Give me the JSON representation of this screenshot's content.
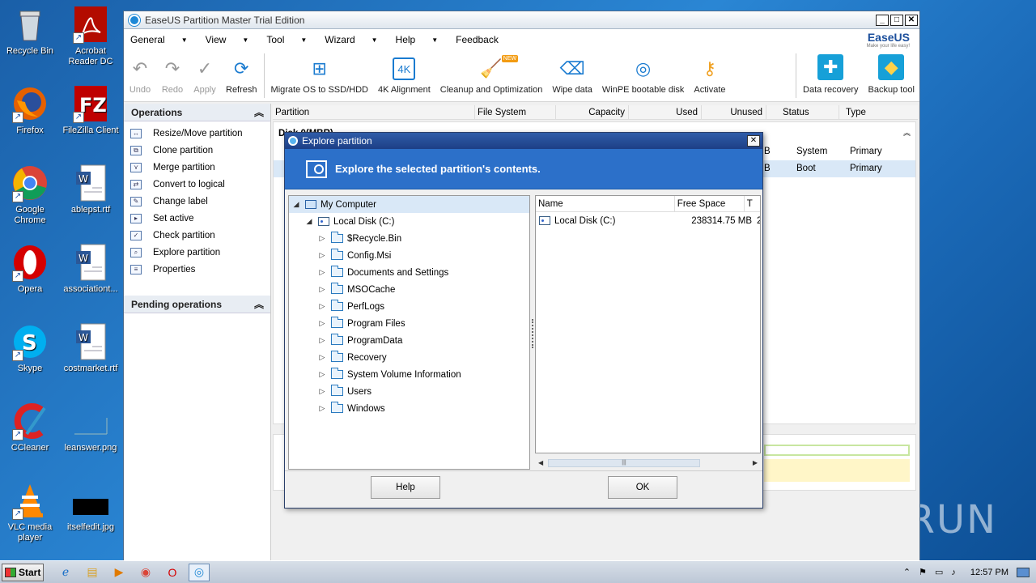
{
  "desktop": {
    "icons": [
      {
        "label": "Recycle Bin",
        "icon": "recycle-bin-icon"
      },
      {
        "label": "Acrobat Reader DC",
        "icon": "acrobat-icon"
      },
      {
        "label": "Firefox",
        "icon": "firefox-icon"
      },
      {
        "label": "FileZilla Client",
        "icon": "filezilla-icon"
      },
      {
        "label": "Google Chrome",
        "icon": "chrome-icon"
      },
      {
        "label": "ablepst.rtf",
        "icon": "word-doc-icon"
      },
      {
        "label": "Opera",
        "icon": "opera-icon"
      },
      {
        "label": "associationt...",
        "icon": "word-doc-icon"
      },
      {
        "label": "Skype",
        "icon": "skype-icon"
      },
      {
        "label": "costmarket.rtf",
        "icon": "word-doc-icon"
      },
      {
        "label": "CCleaner",
        "icon": "ccleaner-icon"
      },
      {
        "label": "leanswer.png",
        "icon": "image-file-icon"
      },
      {
        "label": "VLC media player",
        "icon": "vlc-icon"
      },
      {
        "label": "itselfedit.jpg",
        "icon": "image-file-icon"
      }
    ],
    "watermark": "ANY RUN"
  },
  "app": {
    "title": "EaseUS Partition Master Trial Edition",
    "brand": "EaseUS",
    "brand_tagline": "Make your life easy!",
    "menu": [
      "General",
      "View",
      "Tool",
      "Wizard",
      "Help",
      "Feedback"
    ],
    "toolbar": {
      "undo": "Undo",
      "redo": "Redo",
      "apply": "Apply",
      "refresh": "Refresh",
      "migrate": "Migrate OS to SSD/HDD",
      "align": "4K Alignment",
      "cleanup": "Cleanup and Optimization",
      "cleanup_badge": "NEW",
      "wipe": "Wipe data",
      "winpe": "WinPE bootable disk",
      "activate": "Activate",
      "recovery": "Data recovery",
      "backup": "Backup tool"
    },
    "operations_title": "Operations",
    "operations": [
      "Resize/Move partition",
      "Clone partition",
      "Merge partition",
      "Convert to logical",
      "Change label",
      "Set active",
      "Check partition",
      "Explore partition",
      "Properties"
    ],
    "pending_title": "Pending operations",
    "grid": {
      "headers": [
        "Partition",
        "File System",
        "Capacity",
        "Used",
        "Unused",
        "Status",
        "Type"
      ],
      "disk_label": "Disk 0(MBR)",
      "rows": [
        {
          "unused_tail": "B",
          "status": "System",
          "type": "Primary"
        },
        {
          "unused_tail": "B",
          "status": "Boot",
          "type": "Primary"
        }
      ]
    }
  },
  "dialog": {
    "title": "Explore partition",
    "banner": "Explore the selected partition's contents.",
    "tree": {
      "root": "My Computer",
      "drive": "Local Disk (C:)",
      "folders": [
        "$Recycle.Bin",
        "Config.Msi",
        "Documents and Settings",
        "MSOCache",
        "PerfLogs",
        "Program Files",
        "ProgramData",
        "Recovery",
        "System Volume Information",
        "Users",
        "Windows"
      ]
    },
    "files": {
      "headers": [
        "Name",
        "Free Space",
        "T"
      ],
      "rows": [
        {
          "name": "Local Disk (C:)",
          "free": "238314.75 MB",
          "t": "2"
        }
      ]
    },
    "help_button": "Help",
    "ok_button": "OK"
  },
  "taskbar": {
    "start": "Start",
    "time": "12:57 PM"
  }
}
